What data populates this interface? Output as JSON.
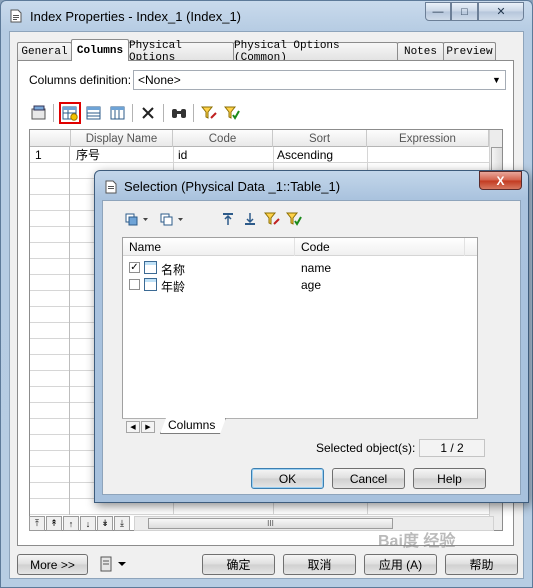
{
  "window": {
    "title": "Index Properties - Index_1 (Index_1)",
    "caption_min": "—",
    "caption_max": "□",
    "caption_close": "✕"
  },
  "tabs": [
    "General",
    "Columns",
    "Physical Options",
    "Physical Options (Common)",
    "Notes",
    "Preview"
  ],
  "columns_definition": {
    "label": "Columns definition:",
    "value": "<None>"
  },
  "grid": {
    "headers": [
      "Display Name",
      "Code",
      "Sort",
      "Expression"
    ],
    "rows": [
      {
        "num": "1",
        "display_name": "序号",
        "code": "id",
        "sort": "Ascending",
        "expression": ""
      }
    ],
    "hscroll_grip": "III"
  },
  "footer": {
    "more_label": "More >>",
    "ok_label": "确定",
    "cancel_label": "取消",
    "apply_label": "应用 (A)",
    "help_label": "帮助"
  },
  "selection_dialog": {
    "title": "Selection (Physical Data _1::Table_1)",
    "close_glyph": "X",
    "list_headers": [
      "Name",
      "Code"
    ],
    "items": [
      {
        "name": "名称",
        "code": "name",
        "checked": true
      },
      {
        "name": "年龄",
        "code": "age",
        "checked": false
      }
    ],
    "list_tab": "Columns",
    "selected_label": "Selected object(s):",
    "selected_value": "1 / 2",
    "ok_label": "OK",
    "cancel_label": "Cancel",
    "help_label": "Help"
  },
  "watermark": "Bai度 经验"
}
